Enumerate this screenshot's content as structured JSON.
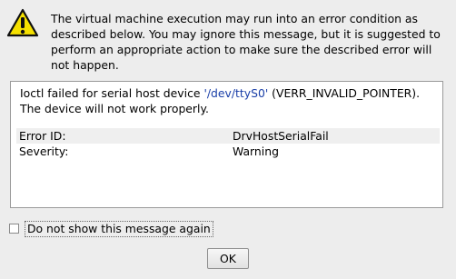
{
  "intro": {
    "text": "The virtual machine execution may run into an error condition as described below. You may ignore this message, but it is suggested to perform an appropriate action to make sure the described error will not happen."
  },
  "details": {
    "msg_prefix": "Ioctl failed for serial host device ",
    "device": "'/dev/ttyS0'",
    "msg_suffix": " (VERR_INVALID_POINTER). The device will not work properly.",
    "rows": [
      {
        "key": "Error ID:",
        "value": "DrvHostSerialFail"
      },
      {
        "key": "Severity:",
        "value": "Warning"
      }
    ]
  },
  "checkbox": {
    "label": "Do not show this message again",
    "checked": false
  },
  "ok_button": {
    "label": "OK"
  },
  "colors": {
    "device_link": "#1a3fa8",
    "icon_yellow": "#f5e000"
  },
  "icons": {
    "warning": "warning-icon"
  }
}
